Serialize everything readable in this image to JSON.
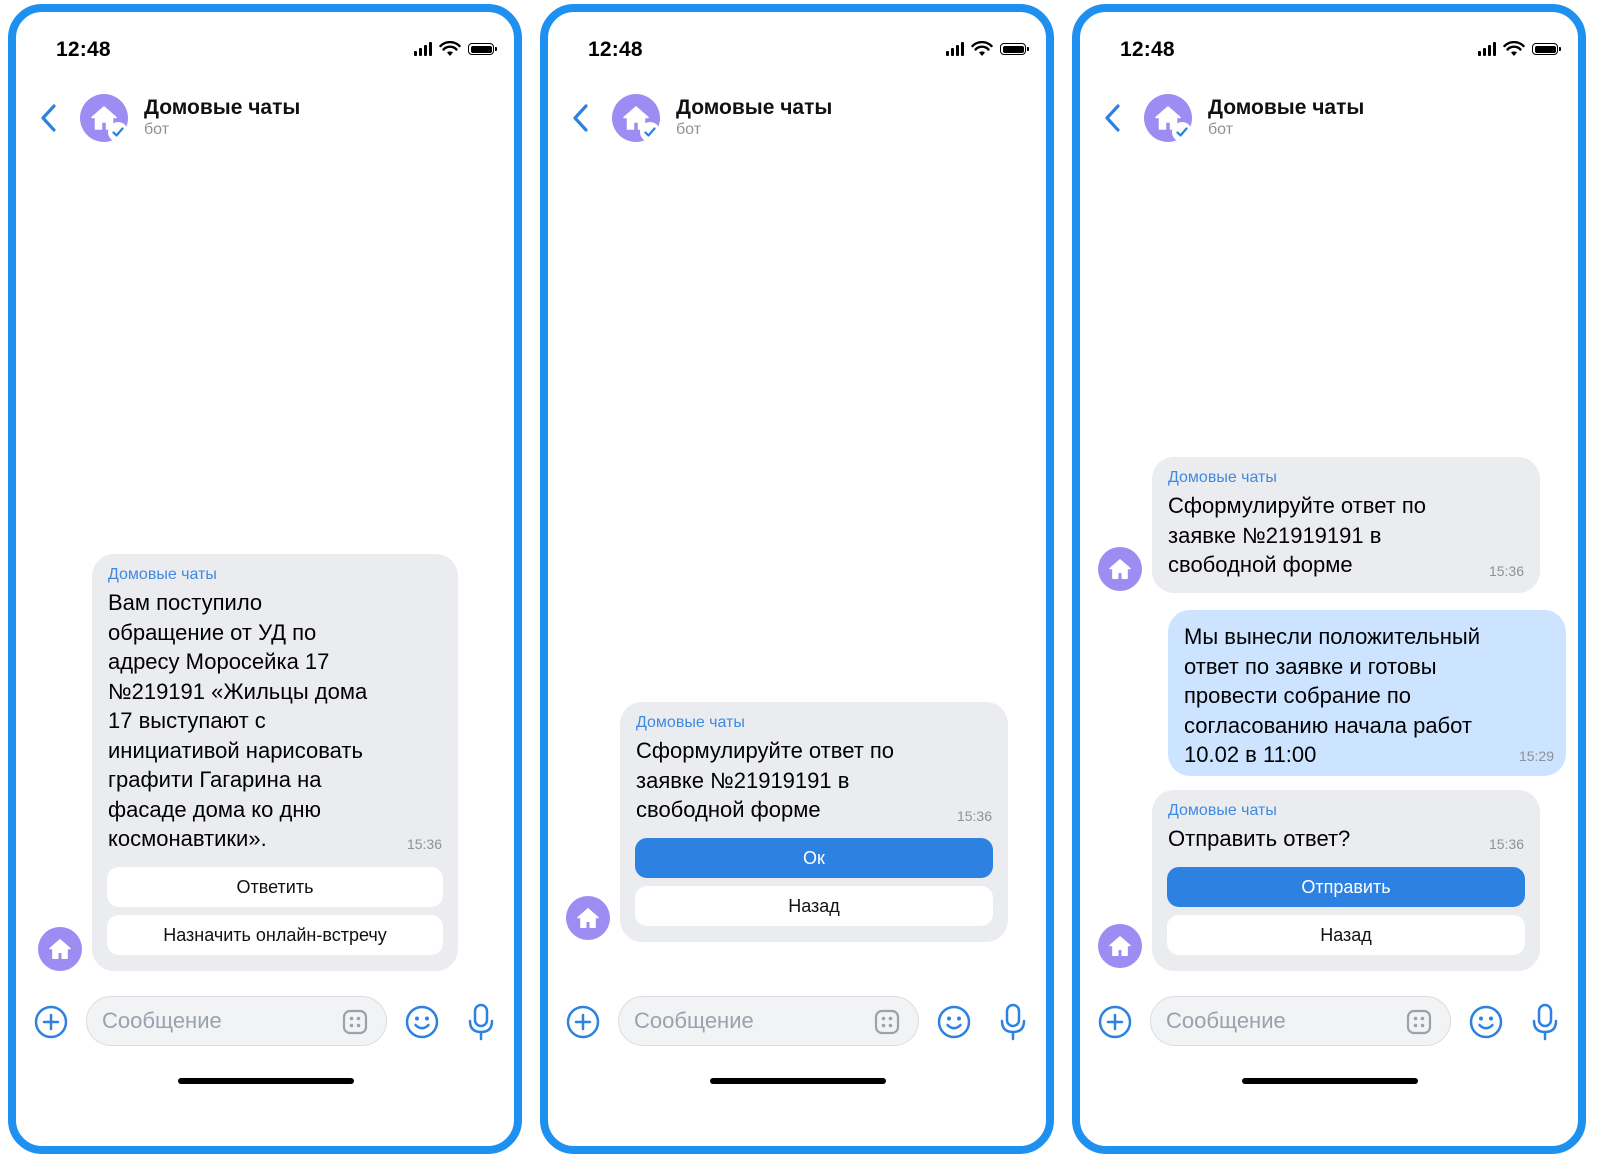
{
  "colors": {
    "frame": "#1E90F0",
    "accent": "#3F8AE0",
    "primary_button": "#2D81E0",
    "incoming_bubble": "#EBECF0",
    "outgoing_bubble": "#CCE4FF",
    "avatar": "#9D8CF2"
  },
  "icons": [
    "chevron-left-icon",
    "house-icon",
    "verified-check-icon",
    "plus-circle-icon",
    "keyboard-icon",
    "smile-icon",
    "microphone-icon",
    "signal-icon",
    "wifi-icon",
    "battery-icon"
  ],
  "screens": [
    {
      "status": {
        "time": "12:48"
      },
      "header": {
        "title": "Домовые чаты",
        "subtitle": "бот"
      },
      "messages": [
        {
          "sender": "Домовые чаты",
          "lines": [
            "Вам поступило",
            "обращение от УД по",
            "адресу Моросейка 17",
            "№219191 «Жильцы дома",
            "17 выступают с",
            "инициативой нарисовать",
            "графити Гагарина на",
            "фасаде дома ко дню",
            "космонавтики»."
          ],
          "time": "15:36",
          "buttons": [
            "Ответить",
            "Назначить онлайн-встречу"
          ]
        }
      ],
      "composer": {
        "placeholder": "Сообщение"
      }
    },
    {
      "status": {
        "time": "12:48"
      },
      "header": {
        "title": "Домовые чаты",
        "subtitle": "бот"
      },
      "messages": [
        {
          "sender": "Домовые чаты",
          "lines": [
            "Сформулируйте ответ по",
            "заявке №21919191 в",
            "свободной форме"
          ],
          "time": "15:36",
          "buttons": [
            "Ок",
            "Назад"
          ]
        }
      ],
      "composer": {
        "placeholder": "Сообщение"
      }
    },
    {
      "status": {
        "time": "12:48"
      },
      "header": {
        "title": "Домовые чаты",
        "subtitle": "бот"
      },
      "messages": [
        {
          "sender": "Домовые чаты",
          "lines": [
            "Сформулируйте ответ по",
            "заявке №21919191 в",
            "свободной форме"
          ],
          "time": "15:36"
        },
        {
          "lines": [
            "Мы вынесли положительный",
            "ответ по заявке и готовы",
            "провести собрание по",
            "согласованию начала работ",
            "10.02  в 11:00"
          ],
          "time": "15:29"
        },
        {
          "sender": "Домовые чаты",
          "lines": [
            "Отправить ответ?"
          ],
          "time": "15:36",
          "buttons": [
            "Отправить",
            "Назад"
          ]
        }
      ],
      "composer": {
        "placeholder": "Сообщение"
      }
    }
  ]
}
